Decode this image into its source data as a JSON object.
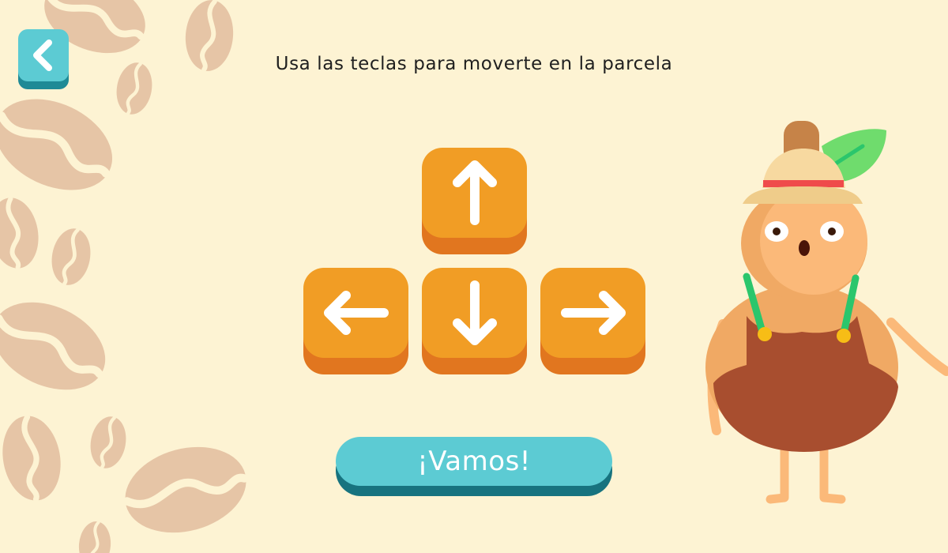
{
  "instruction": "Usa las teclas para moverte en la parcela",
  "back_button": {
    "icon": "chevron-left-icon"
  },
  "arrow_keys": {
    "up": {
      "icon": "arrow-up-icon"
    },
    "left": {
      "icon": "arrow-left-icon"
    },
    "down": {
      "icon": "arrow-down-icon"
    },
    "right": {
      "icon": "arrow-right-icon"
    }
  },
  "start_button": {
    "label": "¡Vamos!"
  },
  "colors": {
    "background": "#fdf3d3",
    "key": "#f19d25",
    "key_shadow": "#e1761f",
    "button": "#5ccbd3",
    "button_shadow": "#17737f",
    "bean": "#e6c5a6"
  }
}
